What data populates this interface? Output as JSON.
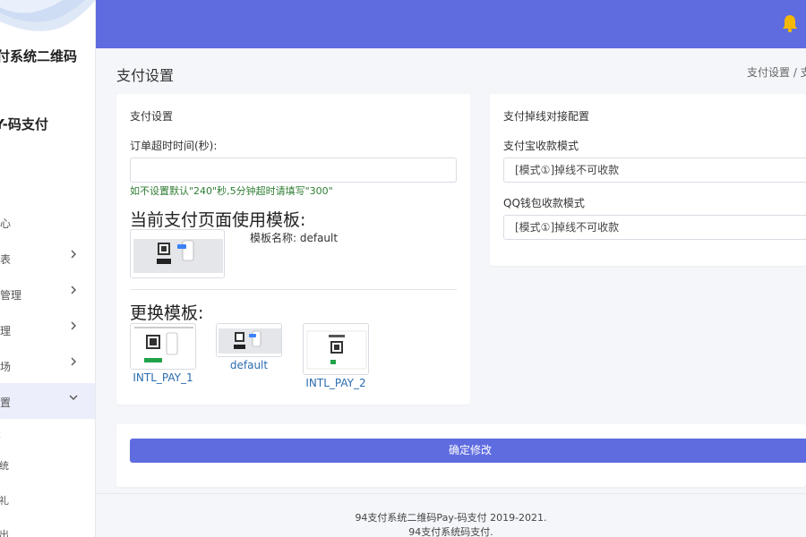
{
  "sidebar": {
    "brand_line1": "付系统二维码",
    "brand_line2": "Y-码支付",
    "items": [
      {
        "label": "中心"
      },
      {
        "label": "列表"
      },
      {
        "label": "码管理"
      },
      {
        "label": "管理"
      },
      {
        "label": "市场"
      },
      {
        "label": "设置"
      }
    ],
    "sub_items": [
      {
        "label": "置"
      },
      {
        "label": "系统"
      },
      {
        "label": "有礼"
      },
      {
        "label": "退出"
      }
    ]
  },
  "header": {
    "bell_icon": "bell-icon",
    "bell_color": "#f5b800",
    "bg_color": "#5f6ce0"
  },
  "page": {
    "title": "支付设置",
    "breadcrumb": "支付设置  /  支"
  },
  "left_card": {
    "title": "支付设置",
    "timeout_label": "订单超时时间(秒):",
    "timeout_value": "",
    "timeout_hint": "如不设置默认\"240\"秒,5分钟超时请填写\"300\"",
    "current_tpl_heading": "当前支付页面使用模板:",
    "current_tpl_name": "模板名称:  default",
    "change_tpl_heading": "更换模板:",
    "templates": [
      {
        "label": "INTL_PAY_1"
      },
      {
        "label": "default"
      },
      {
        "label": "INTL_PAY_2"
      }
    ]
  },
  "right_card": {
    "title": "支付掉线对接配置",
    "alipay_label": "支付宝收款模式",
    "alipay_value": "[模式①]掉线不可收款",
    "qq_label": "QQ钱包收款模式",
    "qq_value": "[模式①]掉线不可收款"
  },
  "submit_label": "确定修改",
  "footer": {
    "line1": "94支付系统二维码Pay-码支付 2019-2021.",
    "line2": "94支付系统码支付."
  }
}
